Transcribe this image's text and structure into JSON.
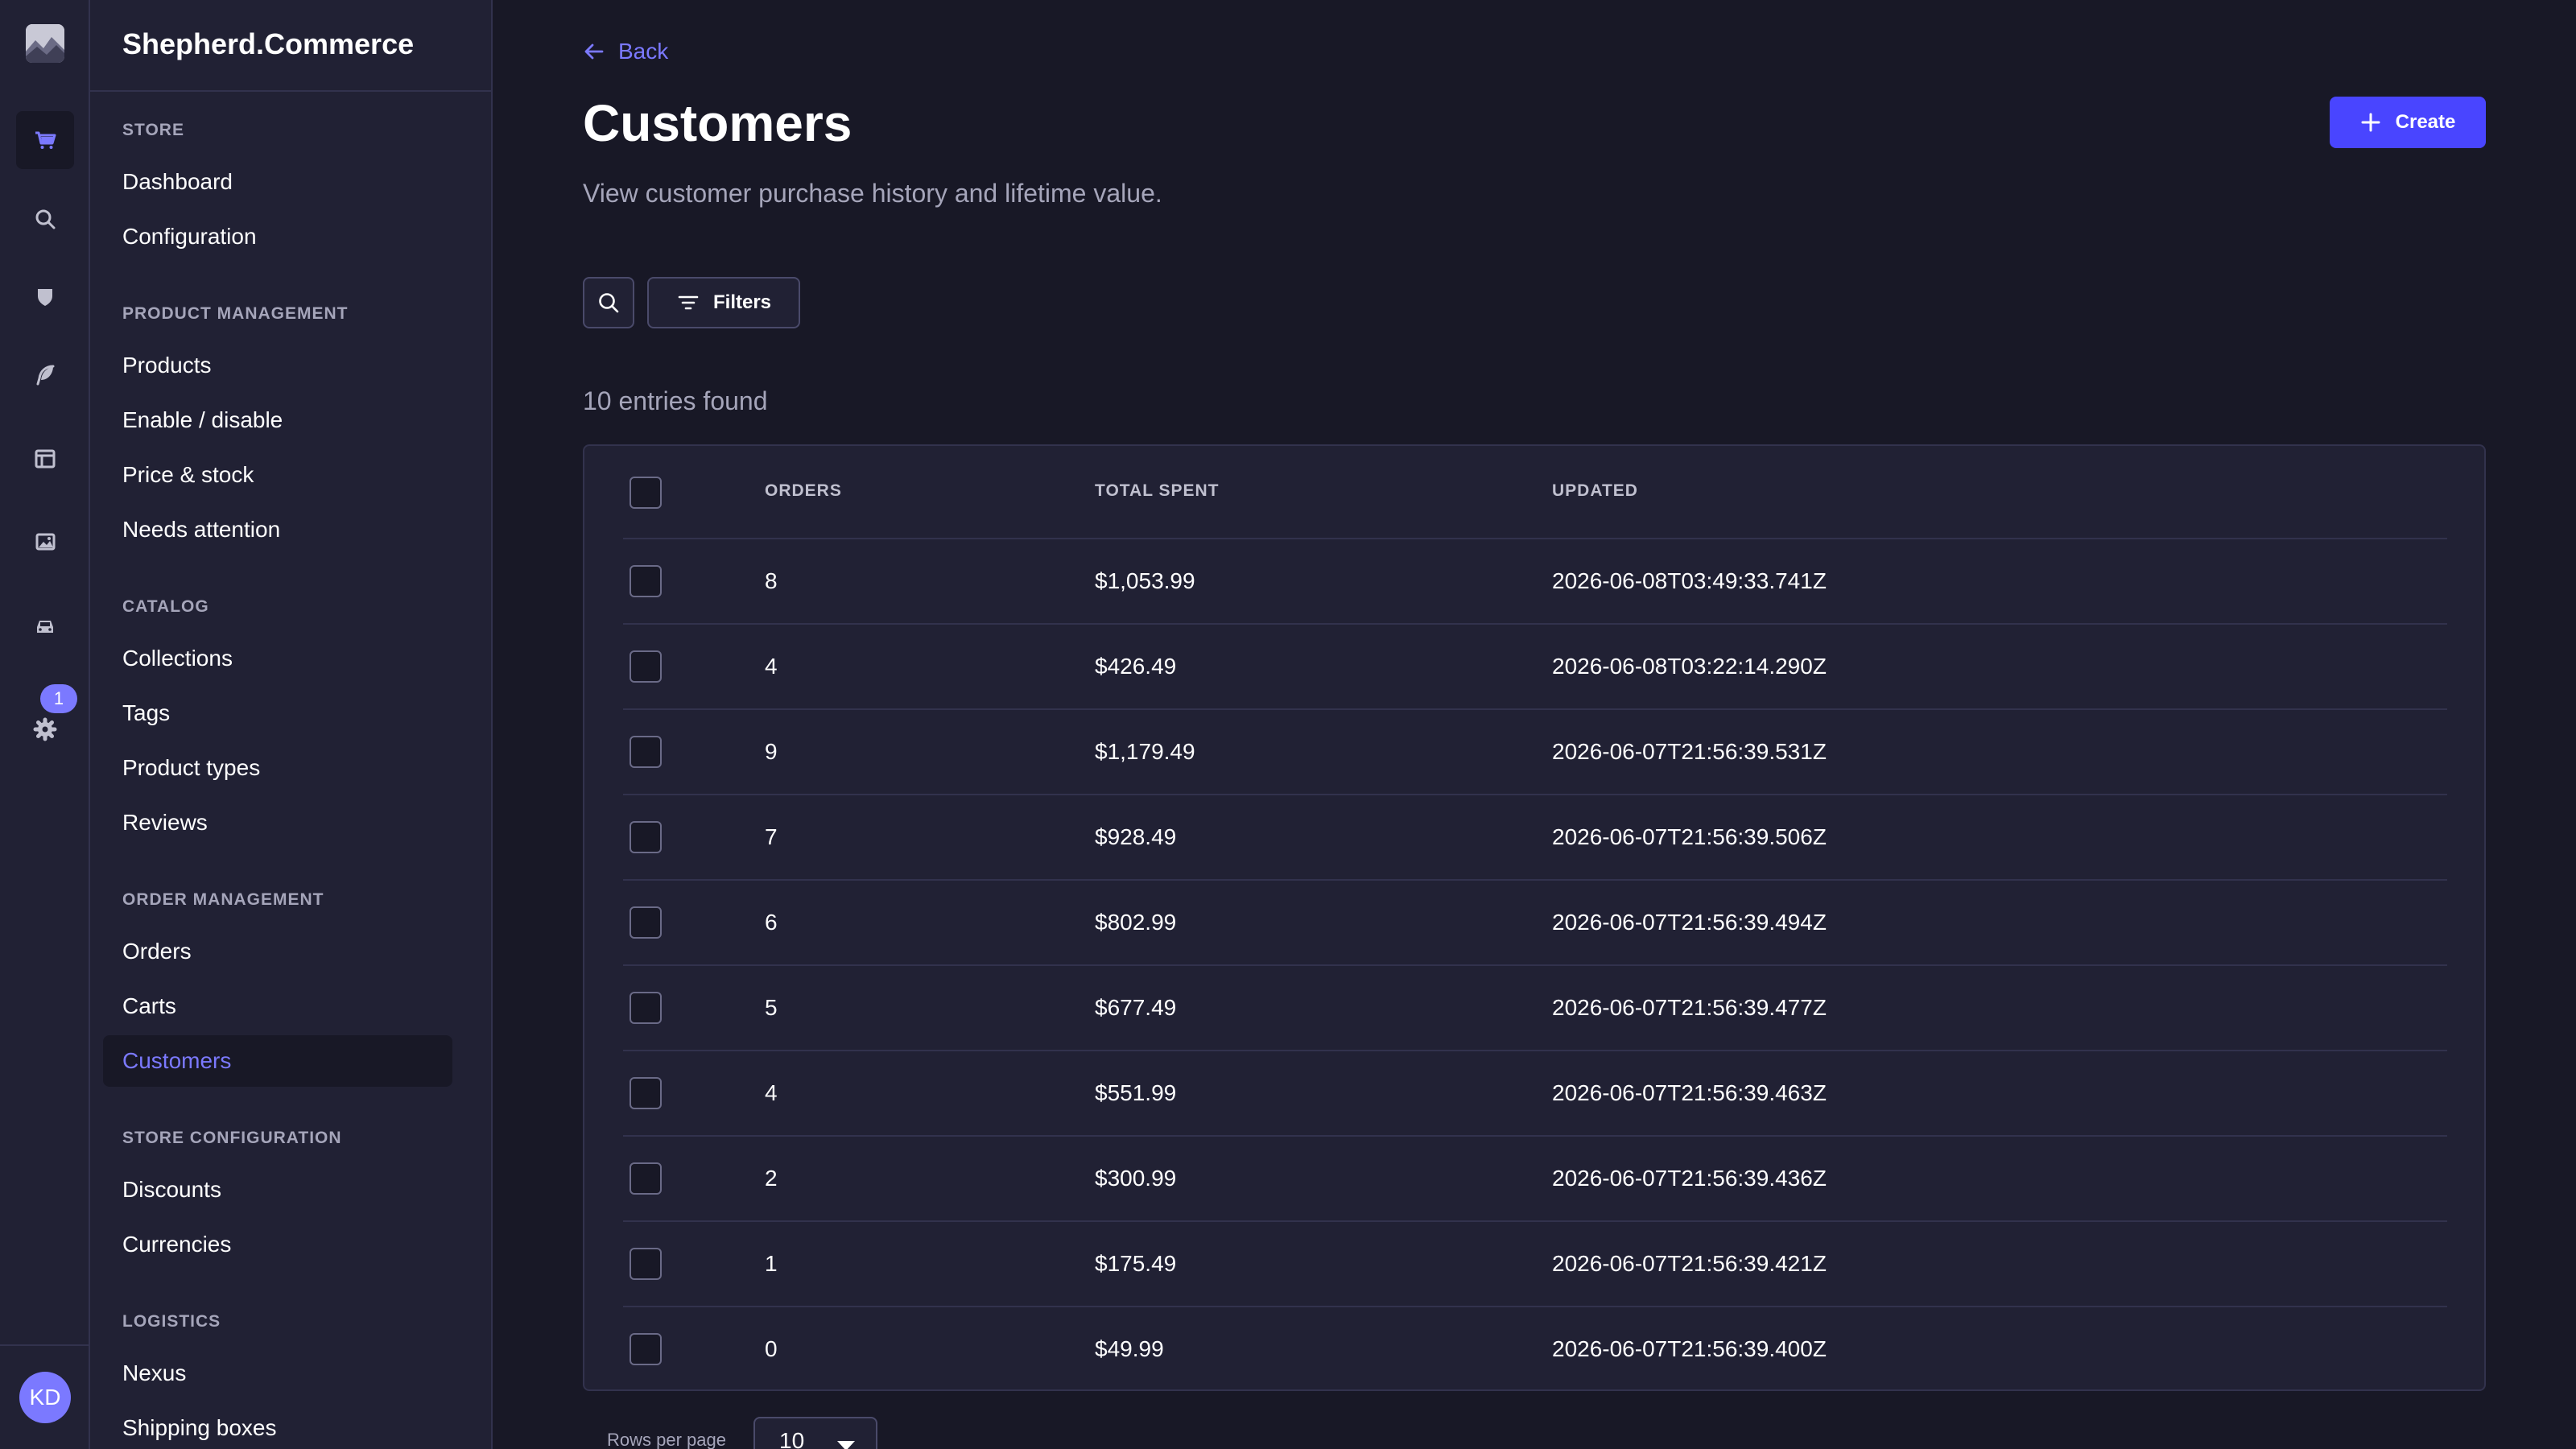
{
  "app": {
    "brand": "Shepherd.Commerce",
    "avatar_initials": "KD",
    "notification_count": "1"
  },
  "rail": [
    {
      "icon": "cart-icon",
      "active": true
    },
    {
      "icon": "search-icon"
    },
    {
      "icon": "shield-icon"
    },
    {
      "icon": "feather-icon"
    },
    {
      "icon": "layout-icon"
    },
    {
      "icon": "images-icon"
    },
    {
      "icon": "car-icon"
    },
    {
      "icon": "gear-icon"
    }
  ],
  "nav": {
    "sections": [
      {
        "title": "STORE",
        "items": [
          "Dashboard",
          "Configuration"
        ]
      },
      {
        "title": "PRODUCT MANAGEMENT",
        "items": [
          "Products",
          "Enable / disable",
          "Price & stock",
          "Needs attention"
        ]
      },
      {
        "title": "CATALOG",
        "items": [
          "Collections",
          "Tags",
          "Product types",
          "Reviews"
        ]
      },
      {
        "title": "ORDER MANAGEMENT",
        "items": [
          "Orders",
          "Carts",
          "Customers"
        ]
      },
      {
        "title": "STORE CONFIGURATION",
        "items": [
          "Discounts",
          "Currencies"
        ]
      },
      {
        "title": "LOGISTICS",
        "items": [
          "Nexus",
          "Shipping boxes"
        ]
      }
    ],
    "active_item": "Customers"
  },
  "header": {
    "back_label": "Back",
    "title": "Customers",
    "subtitle": "View customer purchase history and lifetime value.",
    "create_label": "Create"
  },
  "toolbar": {
    "filters_label": "Filters"
  },
  "entries_label": "10 entries found",
  "table": {
    "columns": [
      "ORDERS",
      "TOTAL SPENT",
      "UPDATED"
    ],
    "rows": [
      {
        "orders": "8",
        "total": "$1,053.99",
        "updated": "2026-06-08T03:49:33.741Z"
      },
      {
        "orders": "4",
        "total": "$426.49",
        "updated": "2026-06-08T03:22:14.290Z"
      },
      {
        "orders": "9",
        "total": "$1,179.49",
        "updated": "2026-06-07T21:56:39.531Z"
      },
      {
        "orders": "7",
        "total": "$928.49",
        "updated": "2026-06-07T21:56:39.506Z"
      },
      {
        "orders": "6",
        "total": "$802.99",
        "updated": "2026-06-07T21:56:39.494Z"
      },
      {
        "orders": "5",
        "total": "$677.49",
        "updated": "2026-06-07T21:56:39.477Z"
      },
      {
        "orders": "4",
        "total": "$551.99",
        "updated": "2026-06-07T21:56:39.463Z"
      },
      {
        "orders": "2",
        "total": "$300.99",
        "updated": "2026-06-07T21:56:39.436Z"
      },
      {
        "orders": "1",
        "total": "$175.49",
        "updated": "2026-06-07T21:56:39.421Z"
      },
      {
        "orders": "0",
        "total": "$49.99",
        "updated": "2026-06-07T21:56:39.400Z"
      }
    ]
  },
  "pagination": {
    "rows_per_page_label": "Rows per page",
    "rows_per_page_value": "10"
  },
  "colors": {
    "accent": "#7b79ff",
    "primary_button": "#4945ff",
    "background": "#181826",
    "panel": "#212134"
  }
}
